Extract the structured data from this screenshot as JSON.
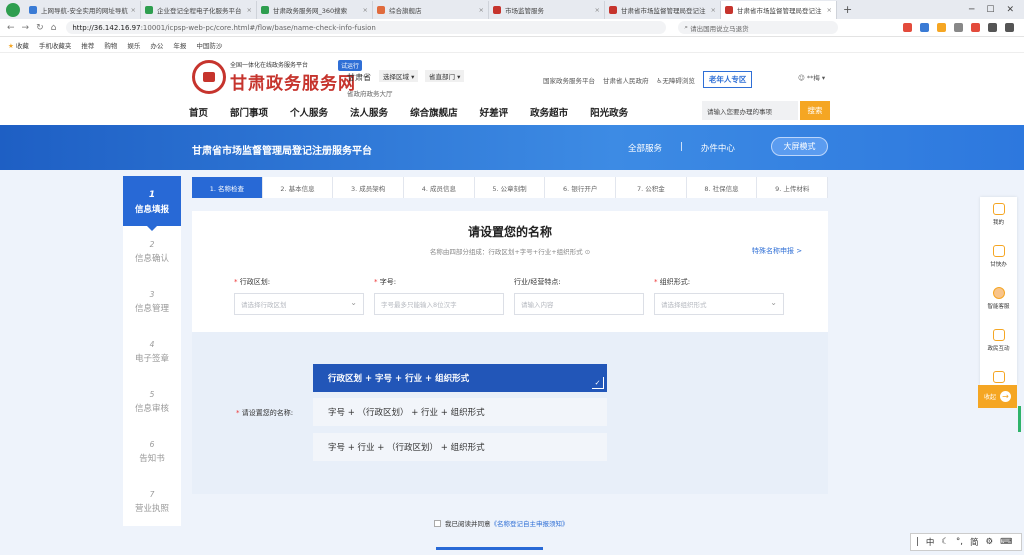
{
  "browser": {
    "tabs": [
      {
        "label": "上网导航-安全实用的网址导航",
        "color": "#3a7bd5"
      },
      {
        "label": "企业登记全程电子化服务平台",
        "color": "#2e9e4f"
      },
      {
        "label": "甘肃政务服务网_360搜索",
        "color": "#2e9e4f"
      },
      {
        "label": "综合旗舰店",
        "color": "#e06b3d"
      },
      {
        "label": "市场监管服务",
        "color": "#c6342d"
      },
      {
        "label": "甘肃省市场监督管理局登记注",
        "color": "#c6342d"
      },
      {
        "label": "甘肃省市场监督管理局登记注",
        "color": "#c6342d"
      }
    ],
    "new_tab": "+",
    "url_host": "http://36.142.16.97",
    "url_path": ":10001/icpsp-web-pc/core.html#/flow/base/name-check-info-fusion",
    "search_placeholder": "请出国用说立马退货",
    "bookmarks": [
      "收藏",
      "手机收藏夹",
      "推荐",
      "购物",
      "娱乐",
      "办公",
      "年报",
      "中国防沙"
    ]
  },
  "header": {
    "logo_small": "全国一体化在线政务服务平台",
    "logo_big": "甘肃政务服务网",
    "pilot_badge": "试运行",
    "province": "甘肃省",
    "region_select": "选择区域",
    "dept_select": "省直部门",
    "sub_hall": "省政府政务大厅",
    "top_links": [
      "国家政务服务平台",
      "甘肃省人民政府",
      "无障碍浏览"
    ],
    "elder_button": "老年人专区",
    "user": "**梅",
    "nav": [
      "首页",
      "部门事项",
      "个人服务",
      "法人服务",
      "综合旗舰店",
      "好差评",
      "政务超市",
      "阳光政务"
    ],
    "search_placeholder": "请输入您要办理的事项",
    "search_button": "搜索"
  },
  "banner": {
    "title": "甘肃省市场监督管理局登记注册服务平台",
    "links": [
      "全部服务",
      "办件中心"
    ],
    "bigscreen": "大屏模式"
  },
  "left_steps": [
    {
      "num": "1",
      "label": "信息填报",
      "active": true
    },
    {
      "num": "2",
      "label": "信息确认",
      "active": false
    },
    {
      "num": "3",
      "label": "信息管理",
      "active": false
    },
    {
      "num": "4",
      "label": "电子签章",
      "active": false
    },
    {
      "num": "5",
      "label": "信息审核",
      "active": false
    },
    {
      "num": "6",
      "label": "告知书",
      "active": false
    },
    {
      "num": "7",
      "label": "营业执照",
      "active": false
    }
  ],
  "progress": [
    "1. 名称检查",
    "2. 基本信息",
    "3. 成员架构",
    "4. 成员信息",
    "5. 公章刻制",
    "6. 银行开户",
    "7. 公积金",
    "8. 社保信息",
    "9. 上传材料"
  ],
  "form": {
    "title": "请设置您的名称",
    "hint": "名称由四部分组成：行政区划+字号+行业+组织形式",
    "special_link": "特殊名称申报 >",
    "fields": [
      {
        "label": "行政区划:",
        "required": true,
        "placeholder": "请选择行政区划"
      },
      {
        "label": "字号:",
        "required": true,
        "placeholder": "字号最多只能输入8位汉字"
      },
      {
        "label": "行业/经营特点:",
        "required": false,
        "placeholder": "请输入内容"
      },
      {
        "label": "组织形式:",
        "required": true,
        "placeholder": "请选择组织形式"
      }
    ]
  },
  "name_combo": {
    "label": "请设置您的名称:",
    "options": [
      "行政区划 + 字号 + 行业 + 组织形式",
      "字号 + （行政区划） + 行业 + 组织形式",
      "字号 + 行业 + （行政区划） + 组织形式"
    ],
    "selected_index": 0
  },
  "agreement": {
    "prefix": "我已阅读并同意",
    "link": "《名称登记自主申报须知》"
  },
  "right_sidebar": [
    "我的",
    "甘快办",
    "智能客服",
    "政民互动",
    "12345"
  ],
  "right_collapse": "收起",
  "ime": [
    "中",
    "简"
  ]
}
